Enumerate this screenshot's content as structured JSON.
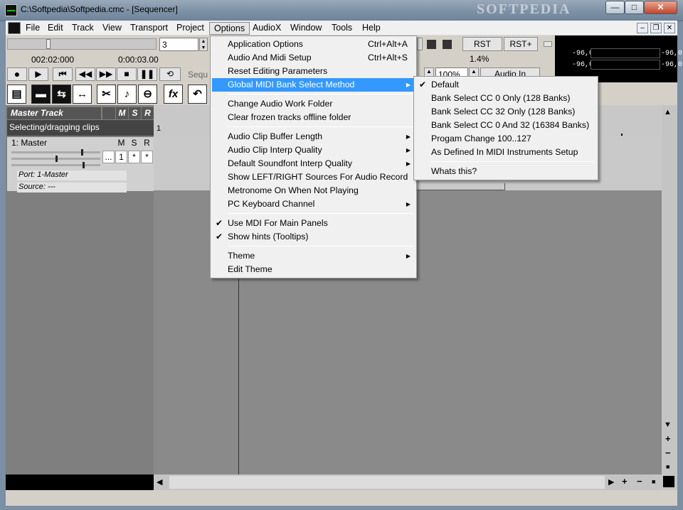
{
  "window": {
    "title": "C:\\Softpedia\\Softpedia.cmc - [Sequencer]",
    "watermark": "SOFTPEDIA",
    "min": "—",
    "max": "□",
    "close": "✕"
  },
  "menubar": [
    "File",
    "Edit",
    "Track",
    "View",
    "Transport",
    "Project",
    "Options",
    "AudioX",
    "Window",
    "Tools",
    "Help"
  ],
  "mdi": {
    "min": "–",
    "restore": "❐",
    "close": "✕"
  },
  "transport": {
    "counter_value": "3",
    "time1": "002:02:000",
    "time2": "0:00:03.00",
    "rst": "RST",
    "rst_plus": "RST+",
    "percent": "1.4%",
    "zoom": "100%",
    "audio_in": "Audio In",
    "seq_partial": "Sequ"
  },
  "meters": {
    "l_left": "-96,0",
    "l_right": "-96,0",
    "r_left": "-96,0",
    "r_right": "-96,0"
  },
  "tools": [
    "▤",
    "▬",
    "⇆",
    "↔",
    "✂",
    "♪",
    "⊖",
    "fx",
    "↶"
  ],
  "track_panel": {
    "master_track": "Master Track",
    "m": "M",
    "s": "S",
    "r": "R",
    "hint": "Selecting/dragging clips",
    "track_name": "1: Master",
    "track_m": "M",
    "track_s": "S",
    "track_r": "R",
    "dots": "...",
    "num": "1",
    "star1": "*",
    "star2": "*",
    "port": "Port: 1-Master",
    "source": "Source: ---"
  },
  "ruler": {
    "bar1": "1"
  },
  "scroll": {
    "up": "▲",
    "down": "▼",
    "plus": "+",
    "minus": "−",
    "stop": "■",
    "left": "◀",
    "right": "▶"
  },
  "options_menu": [
    {
      "label": "Application Options",
      "shortcut": "Ctrl+Alt+A"
    },
    {
      "label": "Audio And Midi Setup",
      "shortcut": "Ctrl+Alt+S"
    },
    {
      "label": "Reset Editing Parameters"
    },
    {
      "label": "Global MIDI Bank Select Method",
      "submenu": true,
      "highlighted": true
    },
    {
      "label": "Change Audio Work Folder"
    },
    {
      "label": "Clear frozen tracks offline folder"
    },
    {
      "label": "Audio Clip Buffer Length",
      "submenu": true
    },
    {
      "label": "Audio Clip Interp Quality",
      "submenu": true
    },
    {
      "label": "Default Soundfont Interp Quality",
      "submenu": true
    },
    {
      "label": "Show LEFT/RIGHT Sources For Audio Record"
    },
    {
      "label": "Metronome On When Not Playing"
    },
    {
      "label": "PC Keyboard Channel",
      "submenu": true
    },
    {
      "label": "Use MDI For Main Panels",
      "checked": true
    },
    {
      "label": "Show hints (Tooltips)",
      "checked": true
    },
    {
      "label": "Theme",
      "submenu": true
    },
    {
      "label": "Edit Theme"
    }
  ],
  "bank_submenu": [
    {
      "label": "Default",
      "checked": true
    },
    {
      "label": "Bank Select CC 0 Only (128 Banks)"
    },
    {
      "label": "Bank Select CC 32 Only (128 Banks)"
    },
    {
      "label": "Bank Select CC 0 And 32 (16384 Banks)"
    },
    {
      "label": "Progam Change 100..127"
    },
    {
      "label": "As Defined In MIDI Instruments Setup"
    },
    {
      "label": "Whats this?"
    }
  ],
  "colors": {
    "highlight": "#3399ff",
    "titlebar": "#7b8fa5"
  }
}
